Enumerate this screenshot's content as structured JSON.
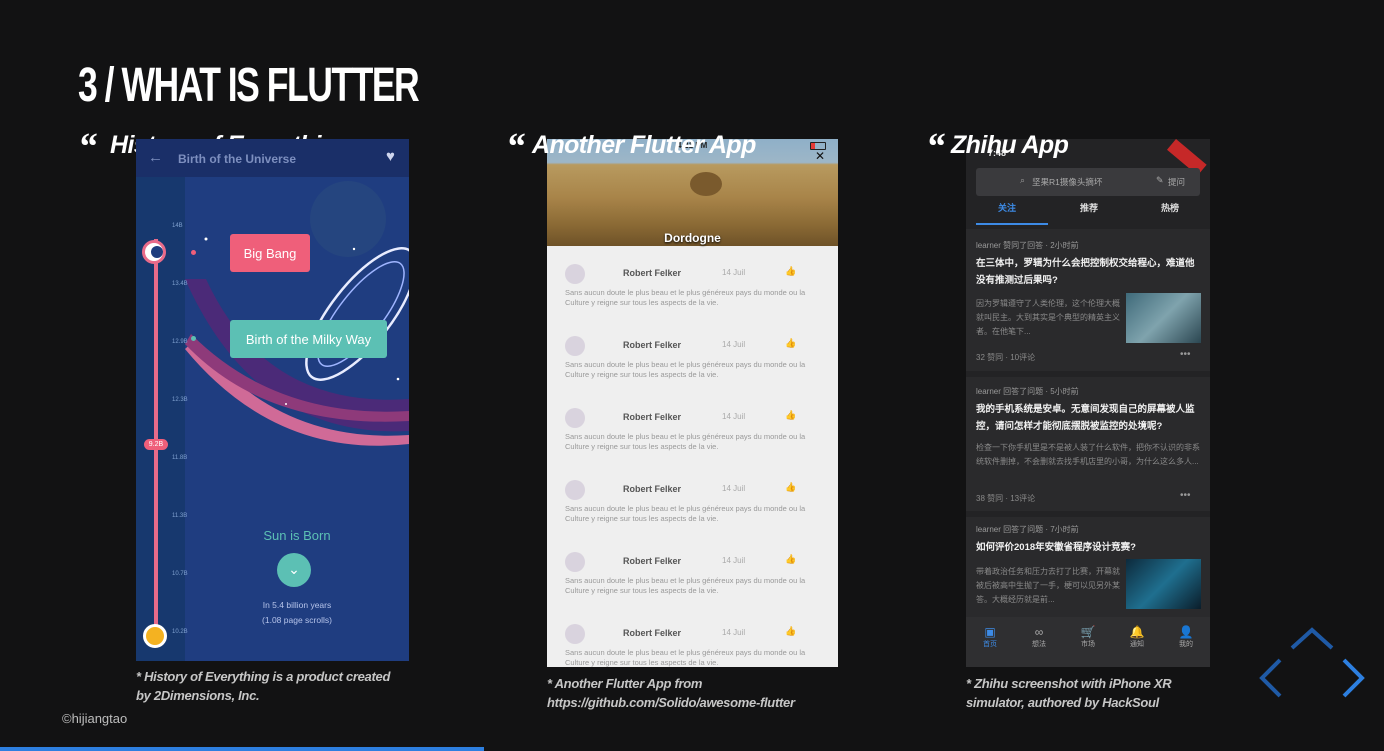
{
  "slide": {
    "title": "3 / WHAT IS FLUTTER",
    "credit": "©hijiangtao"
  },
  "columns": [
    {
      "heading": "History of Everything",
      "caption_line1": "* History of Everything is a product created",
      "caption_line2": "by 2Dimensions, Inc."
    },
    {
      "heading": "Another Flutter App",
      "caption_line1": "* Another Flutter App from",
      "caption_line2": "https://github.com/Solido/awesome-flutter"
    },
    {
      "heading": "Zhihu App",
      "caption_line1": "* Zhihu screenshot with iPhone XR",
      "caption_line2": "simulator, authored by HackSoul"
    }
  ],
  "phone1": {
    "header_title": "Birth of the Universe",
    "back_icon": "back-arrow-icon",
    "heart_icon": "heart-icon",
    "ticks": [
      "14B",
      "13.4B",
      "12.9B",
      "12.3B",
      "11.8B",
      "11.3B",
      "10.7B",
      "10.2B"
    ],
    "current_tick": "9.2B",
    "event1": "Big Bang",
    "event2": "Birth of the Milky Way",
    "event3": "Sun is Born",
    "sub1": "In 5.4 billion years",
    "sub2": "(1.08 page scrolls)",
    "colors": {
      "pink": "#ef5f7a",
      "teal": "#5cc0b4",
      "navy": "#1e3d7e"
    }
  },
  "phone2": {
    "time": "4:21 PM",
    "place": "Dordogne",
    "close_icon": "close-icon",
    "rows": [
      {
        "name": "Robert Felker",
        "date": "14 Juil",
        "text": "Sans aucun doute le plus beau et le plus généreux pays du monde ou la Culture y reigne sur tous les aspects de la vie."
      },
      {
        "name": "Robert Felker",
        "date": "14 Juil",
        "text": "Sans aucun doute le plus beau et le plus généreux pays du monde ou la Culture y reigne sur tous les aspects de la vie."
      },
      {
        "name": "Robert Felker",
        "date": "14 Juil",
        "text": "Sans aucun doute le plus beau et le plus généreux pays du monde ou la Culture y reigne sur tous les aspects de la vie."
      },
      {
        "name": "Robert Felker",
        "date": "14 Juil",
        "text": "Sans aucun doute le plus beau et le plus généreux pays du monde ou la Culture y reigne sur tous les aspects de la vie."
      },
      {
        "name": "Robert Felker",
        "date": "14 Juil",
        "text": "Sans aucun doute le plus beau et le plus généreux pays du monde ou la Culture y reigne sur tous les aspects de la vie."
      },
      {
        "name": "Robert Felker",
        "date": "14 Juil",
        "text": "Sans aucun doute le plus beau et le plus généreux pays du monde ou la Culture y reigne sur tous les aspects de la vie."
      }
    ]
  },
  "phone3": {
    "time": "7:48",
    "search_placeholder": "坚果R1摄像头摘坏",
    "ask_label": "提问",
    "tabs": [
      "关注",
      "推荐",
      "热榜"
    ],
    "cards": [
      {
        "meta": "learner 赞同了回答 · 2小时前",
        "question": "在三体中，罗辑为什么会把控制权交给程心，难道他没有推测过后果吗?",
        "summary": "因为罗辑遵守了人类伦理，这个伦理大概就叫民主。大到其实是个典型的精英主义者。在他笔下...",
        "stats": "32 赞同 · 10评论"
      },
      {
        "meta": "learner 回答了问题 · 5小时前",
        "question": "我的手机系统是安卓。无意间发现自己的屏幕被人监控，请问怎样才能彻底摆脱被监控的处境呢?",
        "summary": "检查一下你手机里是不是被人装了什么软件，把你不认识的非系统软件删掉，不会删就去找手机店里的小哥，为什么这么多人...",
        "stats": "38 赞同 · 13评论"
      },
      {
        "meta": "learner 回答了问题 · 7小时前",
        "question": "如何评价2018年安徽省程序设计竞赛?",
        "summary": "带着政治任务和压力去打了比赛，开幕就被后被高中生抛了一手，梗可以见另外某答。大概经历就是前..."
      }
    ],
    "nav": [
      "首页",
      "想法",
      "市场",
      "通知",
      "我的"
    ]
  },
  "nav_arrows": {
    "up": "chevron-up-icon",
    "left": "chevron-left-icon",
    "right": "chevron-right-icon",
    "color": "#2d7fe0"
  }
}
